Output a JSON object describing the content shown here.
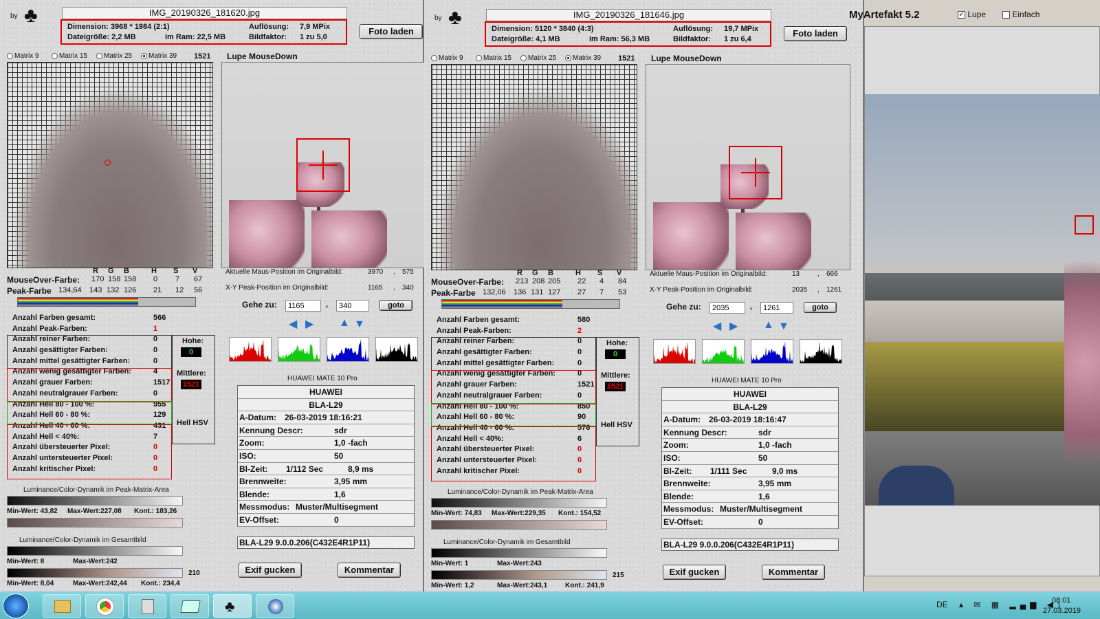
{
  "app": {
    "title": "MyArtefakt 5.2",
    "by": "by",
    "lupe": "Lupe",
    "einfach": "Einfach"
  },
  "panels": [
    {
      "filename": "IMG_20190326_181620.jpg",
      "dim": "Dimension: 3968 * 1984 (2:1)",
      "aufl": "Auflösung:",
      "aufl_val": "7,9 MPix",
      "dsize": "Dateigröße: 2,2 MB",
      "ram": "im Ram: 22,5 MB",
      "bildf": "Bildfaktor:",
      "bildf_val": "1 zu 5,0",
      "foto": "Foto laden",
      "m9": "Matrix 9",
      "m15": "Matrix 15",
      "m25": "Matrix 25",
      "m39": "Matrix 39",
      "mcount": "1521",
      "lupe_title": "Lupe MouseDown",
      "hdr": {
        "r": "R",
        "g": "G",
        "b": "B",
        "h": "H",
        "s": "S",
        "v": "V"
      },
      "mo_label": "MouseOver-Farbe:",
      "mo": [
        "170",
        "158",
        "158",
        "0",
        "7",
        "67"
      ],
      "pk_label": "Peak-Farbe",
      "pk": [
        "134,64",
        "143",
        "132",
        "126",
        "21",
        "12",
        "56"
      ],
      "maus_label": "Aktuelle Maus-Position  im Originalbild:",
      "maus": [
        "3970",
        ",",
        "575"
      ],
      "peak_label": "X-Y Peak-Position  im Originalbild:",
      "peak": [
        "1165",
        ",",
        "340"
      ],
      "gehe": "Gehe zu:",
      "gx": "1165",
      "gy": "340",
      "goto": "goto",
      "stats": [
        [
          "Anzahl Farben gesamt:",
          "566"
        ],
        [
          "Anzahl Peak-Farben:",
          "1"
        ],
        [
          "Anzahl reiner Farben:",
          "0"
        ],
        [
          "Anzahl gesättigter Farben:",
          "0"
        ],
        [
          "Anzahl mittel gesättigter Farben:",
          "0"
        ],
        [
          "Anzahl wenig gesättigter Farben:",
          "4"
        ],
        [
          "Anzahl grauer Farben:",
          "1517"
        ],
        [
          "Anzahl neutralgrauer Farben:",
          "0"
        ],
        [
          "Anzahl Hell 80 - 100 %:",
          "955"
        ],
        [
          "Anzahl Hell 60 - 80 %:",
          "129"
        ],
        [
          "Anzahl Hell 40 - 60 %:",
          "431"
        ],
        [
          "Anzahl Hell < 40%:",
          "7"
        ],
        [
          "Anzahl übersteuerter Pixel:",
          "0"
        ],
        [
          "Anzahl untersteuerter Pixel:",
          "0"
        ],
        [
          "Anzahl kritischer Pixel:",
          "0"
        ]
      ],
      "hohe": "Hohe:",
      "hohe_v": "0",
      "mittlere": "Mittlere:",
      "mittlere_v": "1521",
      "hellhsv": "Hell HSV",
      "cam": "HUAWEI MATE 10 Pro",
      "exif": [
        [
          "HUAWEI",
          ""
        ],
        [
          "BLA-L29",
          ""
        ],
        [
          "A-Datum:",
          "26-03-2019 18:16:21"
        ],
        [
          "Kennung Descr:",
          "sdr"
        ],
        [
          "Zoom:",
          "1,0 -fach"
        ],
        [
          "ISO:",
          "50"
        ],
        [
          "Bl-Zeit:",
          "1/112 Sec",
          "8,9 ms"
        ],
        [
          "Brennweite:",
          "3,95  mm"
        ],
        [
          "Blende:",
          "1,6"
        ],
        [
          "Messmodus:",
          "Muster/Multisegment"
        ],
        [
          "EV-Offset:",
          "0"
        ]
      ],
      "fw": "BLA-L29 9.0.0.206(C432E4R1P11)",
      "dyn1": "Luminance/Color-Dynamik im Peak-Matrix-Area",
      "d1min": "Min-Wert: 43,82",
      "d1max": "Max-Wert:227,08",
      "d1k": "Kont.: 183,26",
      "dyn2": "Luminance/Color-Dynamik im Gesamtbild",
      "d2min": "Min-Wert: 8",
      "d2max": "Max-Wert:242",
      "d2n": "210",
      "d3min": "Min-Wert: 8,04",
      "d3max": "Max-Wert:242,44",
      "d3k": "Kont.: 234,4",
      "exifbtn": "Exif gucken",
      "komm": "Kommentar"
    },
    {
      "filename": "IMG_20190326_181646.jpg",
      "dim": "Dimension: 5120 * 3840 (4:3)",
      "aufl": "Auflösung:",
      "aufl_val": "19,7 MPix",
      "dsize": "Dateigröße: 4,1 MB",
      "ram": "im Ram: 56,3 MB",
      "bildf": "Bildfaktor:",
      "bildf_val": "1 zu 6,4",
      "foto": "Foto laden",
      "m9": "Matrix 9",
      "m15": "Matrix 15",
      "m25": "Matrix 25",
      "m39": "Matrix 39",
      "mcount": "1521",
      "lupe_title": "Lupe MouseDown",
      "hdr": {
        "r": "R",
        "g": "G",
        "b": "B",
        "h": "H",
        "s": "S",
        "v": "V"
      },
      "mo_label": "MouseOver-Farbe:",
      "mo": [
        "213",
        "208",
        "205",
        "22",
        "4",
        "84"
      ],
      "pk_label": "Peak-Farbe",
      "pk": [
        "132,06",
        "136",
        "131",
        "127",
        "27",
        "7",
        "53"
      ],
      "maus_label": "Aktuelle Maus-Position  im Originalbild:",
      "maus": [
        "13",
        ",",
        "666"
      ],
      "peak_label": "X-Y Peak-Position  im Originalbild:",
      "peak": [
        "2035",
        ",",
        "1261"
      ],
      "gehe": "Gehe zu:",
      "gx": "2035",
      "gy": "1261",
      "goto": "goto",
      "stats": [
        [
          "Anzahl Farben gesamt:",
          "580"
        ],
        [
          "Anzahl Peak-Farben:",
          "2"
        ],
        [
          "Anzahl reiner Farben:",
          "0"
        ],
        [
          "Anzahl gesättigter Farben:",
          "0"
        ],
        [
          "Anzahl mittel gesättigter Farben:",
          "0"
        ],
        [
          "Anzahl wenig gesättigter Farben:",
          "0"
        ],
        [
          "Anzahl grauer Farben:",
          "1521"
        ],
        [
          "Anzahl neutralgrauer Farben:",
          "0"
        ],
        [
          "Anzahl Hell 80 - 100 %:",
          "850"
        ],
        [
          "Anzahl Hell 60 - 80 %:",
          "90"
        ],
        [
          "Anzahl Hell 40 - 60 %:",
          "576"
        ],
        [
          "Anzahl Hell < 40%:",
          "6"
        ],
        [
          "Anzahl übersteuerter Pixel:",
          "0"
        ],
        [
          "Anzahl untersteuerter Pixel:",
          "0"
        ],
        [
          "Anzahl kritischer Pixel:",
          "0"
        ]
      ],
      "hohe": "Hohe:",
      "hohe_v": "0",
      "mittlere": "Mittlere:",
      "mittlere_v": "1521",
      "hellhsv": "Hell HSV",
      "cam": "HUAWEI MATE 10 Pro",
      "exif": [
        [
          "HUAWEI",
          ""
        ],
        [
          "BLA-L29",
          ""
        ],
        [
          "A-Datum:",
          "26-03-2019 18:16:47"
        ],
        [
          "Kennung Descr:",
          "sdr"
        ],
        [
          "Zoom:",
          "1,0 -fach"
        ],
        [
          "ISO:",
          "50"
        ],
        [
          "Bl-Zeit:",
          "1/111 Sec",
          "9,0 ms"
        ],
        [
          "Brennweite:",
          "3,95  mm"
        ],
        [
          "Blende:",
          "1,6"
        ],
        [
          "Messmodus:",
          "Muster/Multisegment"
        ],
        [
          "EV-Offset:",
          "0"
        ]
      ],
      "fw": "BLA-L29 9.0.0.206(C432E4R1P11)",
      "dyn1": "Luminance/Color-Dynamik im Peak-Matrix-Area",
      "d1min": "Min-Wert: 74,83",
      "d1max": "Max-Wert:229,35",
      "d1k": "Kont.: 154,52",
      "dyn2": "Luminance/Color-Dynamik im Gesamtbild",
      "d2min": "Min-Wert: 1",
      "d2max": "Max-Wert:243",
      "d2n": "215",
      "d3min": "Min-Wert: 1,2",
      "d3max": "Max-Wert:243,1",
      "d3k": "Kont.: 241,9",
      "exifbtn": "Exif gucken",
      "komm": "Kommentar"
    }
  ],
  "taskbar": {
    "lang": "DE",
    "time": "08:01",
    "date": "27.03.2019"
  },
  "colors": {
    "red": "#dd0000",
    "panel": "#d9d9d9",
    "taskbar": "#6cc6d1"
  }
}
